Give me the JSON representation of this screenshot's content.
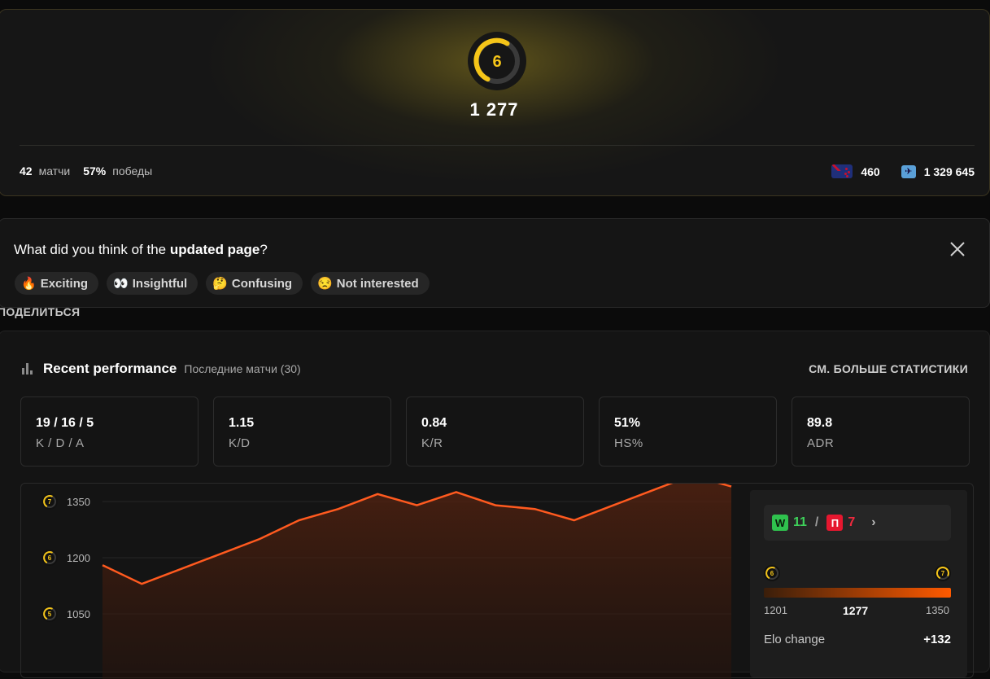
{
  "profile": {
    "level": "6",
    "elo": "1 277",
    "matches_value": "42",
    "matches_label": "матчи",
    "winrate_value": "57%",
    "winrate_label": "победы",
    "country_rank": "460",
    "global_rank": "1 329 645",
    "accent_color": "#f5c518"
  },
  "survey": {
    "question_prefix": "What did you think of the ",
    "question_bold": "updated page",
    "question_suffix": "?",
    "options": [
      {
        "emoji": "🔥",
        "label": "Exciting"
      },
      {
        "emoji": "👀",
        "label": "Insightful"
      },
      {
        "emoji": "🤔",
        "label": "Confusing"
      },
      {
        "emoji": "😒",
        "label": "Not interested"
      }
    ]
  },
  "share_label": "ПОДЕЛИТЬСЯ",
  "performance": {
    "title": "Recent performance",
    "subtitle": "Последние матчи (30)",
    "more_stats": "СМ. БОЛЬШЕ СТАТИСТИКИ",
    "cards": [
      {
        "value": "19 / 16 / 5",
        "label": "K / D / A"
      },
      {
        "value": "1.15",
        "label": "K/D"
      },
      {
        "value": "0.84",
        "label": "K/R"
      },
      {
        "value": "51%",
        "label": "HS%"
      },
      {
        "value": "89.8",
        "label": "ADR"
      }
    ]
  },
  "chart_data": {
    "type": "area",
    "y_ticks": [
      {
        "value": 1350,
        "label": "1350",
        "level": "7"
      },
      {
        "value": 1200,
        "label": "1200",
        "level": "6"
      },
      {
        "value": 1050,
        "label": "1050",
        "level": "5"
      }
    ],
    "ylim": [
      950,
      1400
    ],
    "values": [
      1180,
      1130,
      1170,
      1210,
      1250,
      1300,
      1330,
      1370,
      1340,
      1375,
      1340,
      1330,
      1300,
      1340,
      1380,
      1420,
      1390
    ],
    "line_color": "#ff5a1f"
  },
  "summary": {
    "wins": "11",
    "losses": "7",
    "win_tag": "W",
    "loss_tag": "П",
    "level_from": "6",
    "level_to": "7",
    "range_min": "1201",
    "range_current": "1277",
    "range_max": "1350",
    "elo_change_label": "Elo change",
    "elo_change_value": "+132"
  }
}
